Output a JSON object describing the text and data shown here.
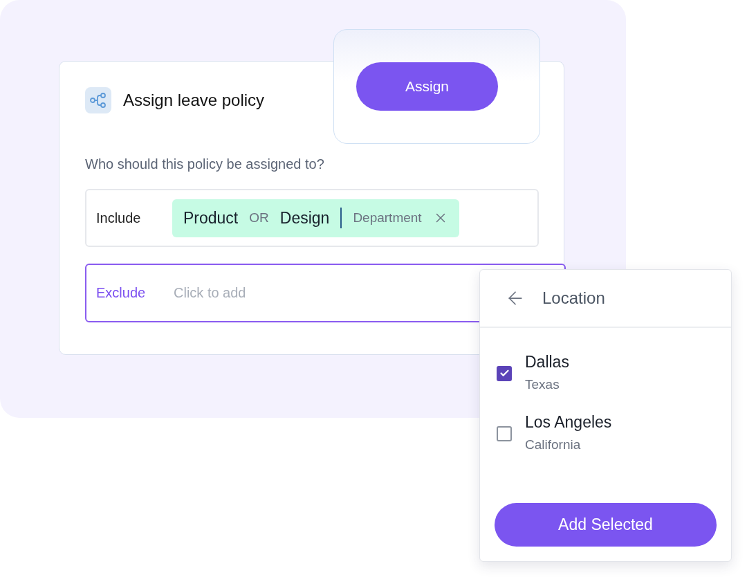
{
  "card": {
    "title": "Assign leave policy",
    "question": "Who should this policy be assigned to?"
  },
  "assign_button": {
    "label": "Assign"
  },
  "include": {
    "label": "Include",
    "tag": {
      "values": [
        "Product",
        "Design"
      ],
      "joiner": "OR",
      "type": "Department"
    }
  },
  "exclude": {
    "label": "Exclude",
    "placeholder": "Click to add",
    "focused": true
  },
  "dropdown": {
    "title": "Location",
    "items": [
      {
        "name": "Dallas",
        "detail": "Texas",
        "checked": true
      },
      {
        "name": "Los Angeles",
        "detail": "California",
        "checked": false
      }
    ],
    "button": "Add Selected"
  }
}
